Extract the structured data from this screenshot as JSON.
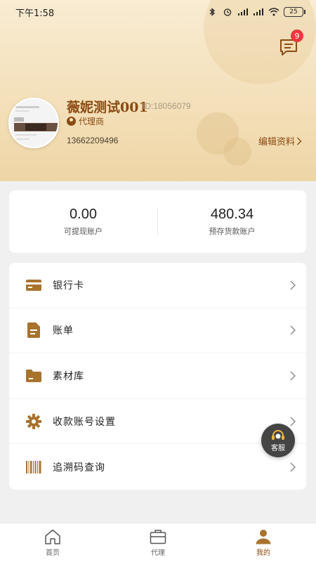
{
  "status_bar": {
    "time": "下午1:58",
    "battery": "25"
  },
  "header": {
    "message_badge": "9",
    "user_name": "薇妮测试001",
    "user_id": "ID:18056079",
    "role": "代理商",
    "phone": "13662209496",
    "edit_label": "编辑资料"
  },
  "balances": [
    {
      "value": "0.00",
      "label": "可提现账户"
    },
    {
      "value": "480.34",
      "label": "预存货款账户"
    }
  ],
  "menu": [
    {
      "label": "银行卡",
      "icon": "bank-card-icon"
    },
    {
      "label": "账单",
      "icon": "bill-icon"
    },
    {
      "label": "素材库",
      "icon": "folder-icon"
    },
    {
      "label": "收款账号设置",
      "icon": "gear-icon"
    },
    {
      "label": "追溯码查询",
      "icon": "barcode-icon"
    }
  ],
  "customer_service": {
    "label": "客服"
  },
  "tabs": [
    {
      "label": "首页",
      "icon": "home-icon",
      "active": false
    },
    {
      "label": "代理",
      "icon": "briefcase-icon",
      "active": false
    },
    {
      "label": "我的",
      "icon": "user-icon",
      "active": true
    }
  ],
  "colors": {
    "accent": "#8a4b12",
    "icon_brown": "#a8732d",
    "badge": "#e9393f"
  }
}
